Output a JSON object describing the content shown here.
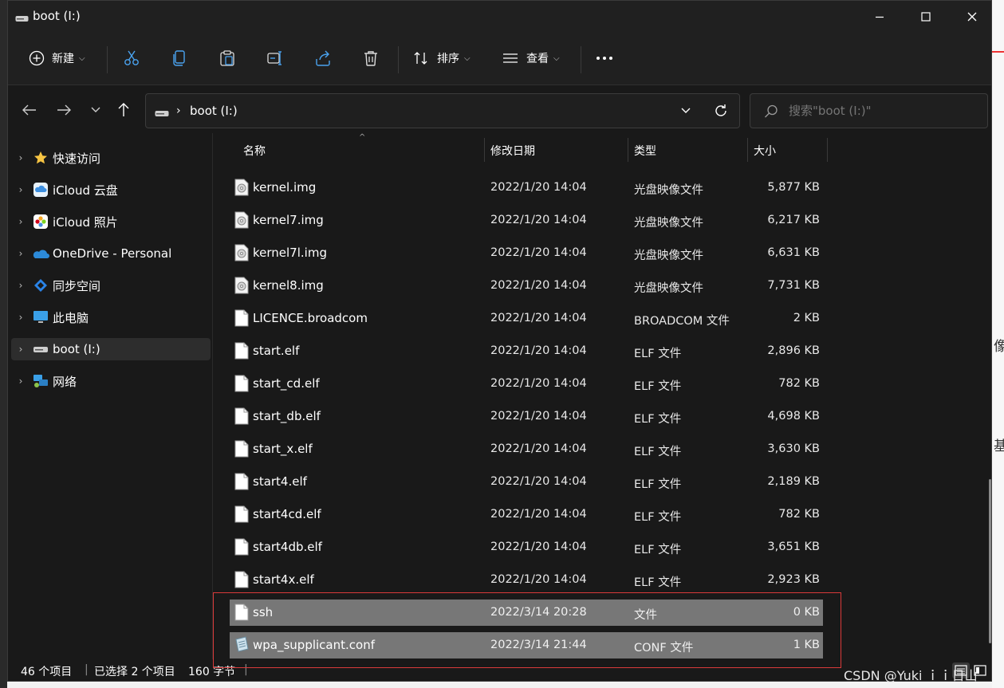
{
  "window": {
    "title": "boot (I:)"
  },
  "commands": {
    "new": "新建",
    "sort": "排序",
    "view": "查看"
  },
  "address": {
    "crumb": "boot (I:)",
    "search_placeholder": "搜索\"boot (I:)\""
  },
  "sidebar": {
    "items": [
      {
        "label": "快速访问"
      },
      {
        "label": "iCloud 云盘"
      },
      {
        "label": "iCloud 照片"
      },
      {
        "label": "OneDrive - Personal"
      },
      {
        "label": "同步空间"
      },
      {
        "label": "此电脑"
      },
      {
        "label": "boot (I:)"
      },
      {
        "label": "网络"
      }
    ]
  },
  "columns": {
    "name": "名称",
    "modified": "修改日期",
    "type": "类型",
    "size": "大小"
  },
  "files": [
    {
      "name": "kernel.img",
      "date": "2022/1/20 14:04",
      "type": "光盘映像文件",
      "size": "5,877 KB",
      "icon": "disc-image-icon"
    },
    {
      "name": "kernel7.img",
      "date": "2022/1/20 14:04",
      "type": "光盘映像文件",
      "size": "6,217 KB",
      "icon": "disc-image-icon"
    },
    {
      "name": "kernel7l.img",
      "date": "2022/1/20 14:04",
      "type": "光盘映像文件",
      "size": "6,631 KB",
      "icon": "disc-image-icon"
    },
    {
      "name": "kernel8.img",
      "date": "2022/1/20 14:04",
      "type": "光盘映像文件",
      "size": "7,731 KB",
      "icon": "disc-image-icon"
    },
    {
      "name": "LICENCE.broadcom",
      "date": "2022/1/20 14:04",
      "type": "BROADCOM 文件",
      "size": "2 KB",
      "icon": "file-icon"
    },
    {
      "name": "start.elf",
      "date": "2022/1/20 14:04",
      "type": "ELF 文件",
      "size": "2,896 KB",
      "icon": "file-icon"
    },
    {
      "name": "start_cd.elf",
      "date": "2022/1/20 14:04",
      "type": "ELF 文件",
      "size": "782 KB",
      "icon": "file-icon"
    },
    {
      "name": "start_db.elf",
      "date": "2022/1/20 14:04",
      "type": "ELF 文件",
      "size": "4,698 KB",
      "icon": "file-icon"
    },
    {
      "name": "start_x.elf",
      "date": "2022/1/20 14:04",
      "type": "ELF 文件",
      "size": "3,630 KB",
      "icon": "file-icon"
    },
    {
      "name": "start4.elf",
      "date": "2022/1/20 14:04",
      "type": "ELF 文件",
      "size": "2,189 KB",
      "icon": "file-icon"
    },
    {
      "name": "start4cd.elf",
      "date": "2022/1/20 14:04",
      "type": "ELF 文件",
      "size": "782 KB",
      "icon": "file-icon"
    },
    {
      "name": "start4db.elf",
      "date": "2022/1/20 14:04",
      "type": "ELF 文件",
      "size": "3,651 KB",
      "icon": "file-icon"
    },
    {
      "name": "start4x.elf",
      "date": "2022/1/20 14:04",
      "type": "ELF 文件",
      "size": "2,923 KB",
      "icon": "file-icon"
    },
    {
      "name": "ssh",
      "date": "2022/3/14 20:28",
      "type": "文件",
      "size": "0 KB",
      "icon": "file-icon",
      "selected": true
    },
    {
      "name": "wpa_supplicant.conf",
      "date": "2022/3/14 21:44",
      "type": "CONF 文件",
      "size": "1 KB",
      "icon": "config-file-icon",
      "selected": true
    }
  ],
  "status": {
    "count": "46 个项目",
    "selected": "已选择 2 个项目",
    "bytes": "160 字节"
  },
  "watermark": "CSDN @Yuki ｉｉ日山",
  "background_fragments": [
    "像",
    "基"
  ],
  "colors": {
    "selection": "#777777",
    "highlight_box": "#d93a3a",
    "window_bg": "#191919"
  }
}
